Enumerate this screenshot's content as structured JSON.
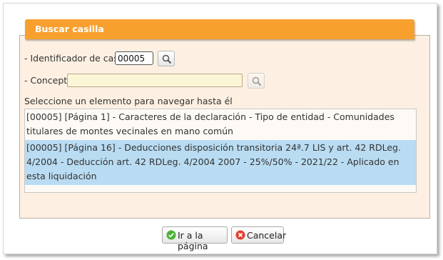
{
  "header": {
    "title": "Buscar casilla"
  },
  "form": {
    "id_label": "- Identificador de casilla",
    "id_value": "00005",
    "concept_label": "- Concepto",
    "concept_value": "",
    "list_caption": "Seleccione un elemento para navegar hasta él"
  },
  "results": [
    "[00005] [Página 1] - Caracteres de la declaración - Tipo de entidad - Comunidades titulares de montes vecinales en mano común",
    "[00005] [Página 16] - Deducciones disposición transitoria 24ª.7 LIS y art. 42 RDLeg. 4/2004 - Deducción art. 42 RDLeg. 4/2004 2007 - 25%/50% - 2021/22 - Aplicado en esta liquidación"
  ],
  "selected_index": 1,
  "buttons": {
    "go": "Ir a la página",
    "cancel": "Cancelar"
  },
  "icons": {
    "search": "magnifier-icon",
    "go": "check-icon",
    "cancel": "close-icon"
  },
  "colors": {
    "header": "#f7a02e",
    "panel_bg": "#fdf0e2",
    "selected_row": "#b9dcf2",
    "concept_bg": "#fcf6d7"
  }
}
